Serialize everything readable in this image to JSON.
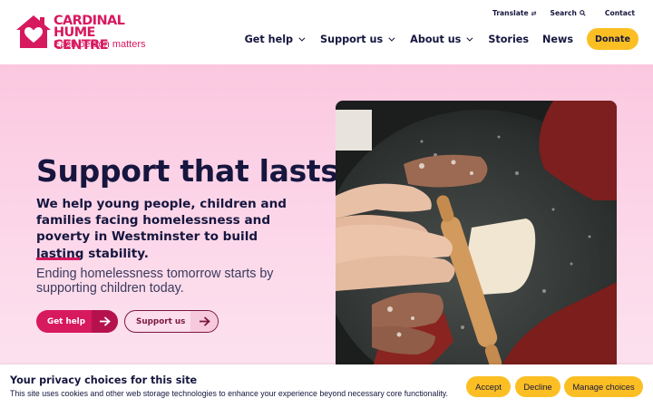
{
  "brand": {
    "name_line1": "CARDINAL",
    "name_line2": "HUME CENTRE",
    "tagline": "Each person matters",
    "color": "#d7195e"
  },
  "utility_nav": {
    "translate": "Translate",
    "search": "Search",
    "contact": "Contact"
  },
  "main_nav": {
    "items": [
      {
        "label": "Get help",
        "has_dropdown": true
      },
      {
        "label": "Support us",
        "has_dropdown": true
      },
      {
        "label": "About us",
        "has_dropdown": true
      },
      {
        "label": "Stories",
        "has_dropdown": false
      },
      {
        "label": "News",
        "has_dropdown": false
      }
    ],
    "donate_label": "Donate"
  },
  "hero": {
    "title": "Support that lasts",
    "lede": "We help young people, children and families facing homelessness and poverty in Westminster to build lasting stability.",
    "subtext": "Ending homelessness tomorrow starts by supporting children today.",
    "primary_button": "Get help",
    "secondary_button": "Support us",
    "image_icon": "photo-hands-kneading-dough"
  },
  "cookie_banner": {
    "title": "Your privacy choices for this site",
    "text": "This site uses cookies and other web storage technologies to enhance your experience beyond necessary core functionality.",
    "accept": "Accept",
    "decline": "Decline",
    "manage": "Manage choices"
  },
  "colors": {
    "accent": "#d7195e",
    "navy": "#16163f",
    "donate": "#fbbf24",
    "hero_bg": "#fbc8e0"
  }
}
